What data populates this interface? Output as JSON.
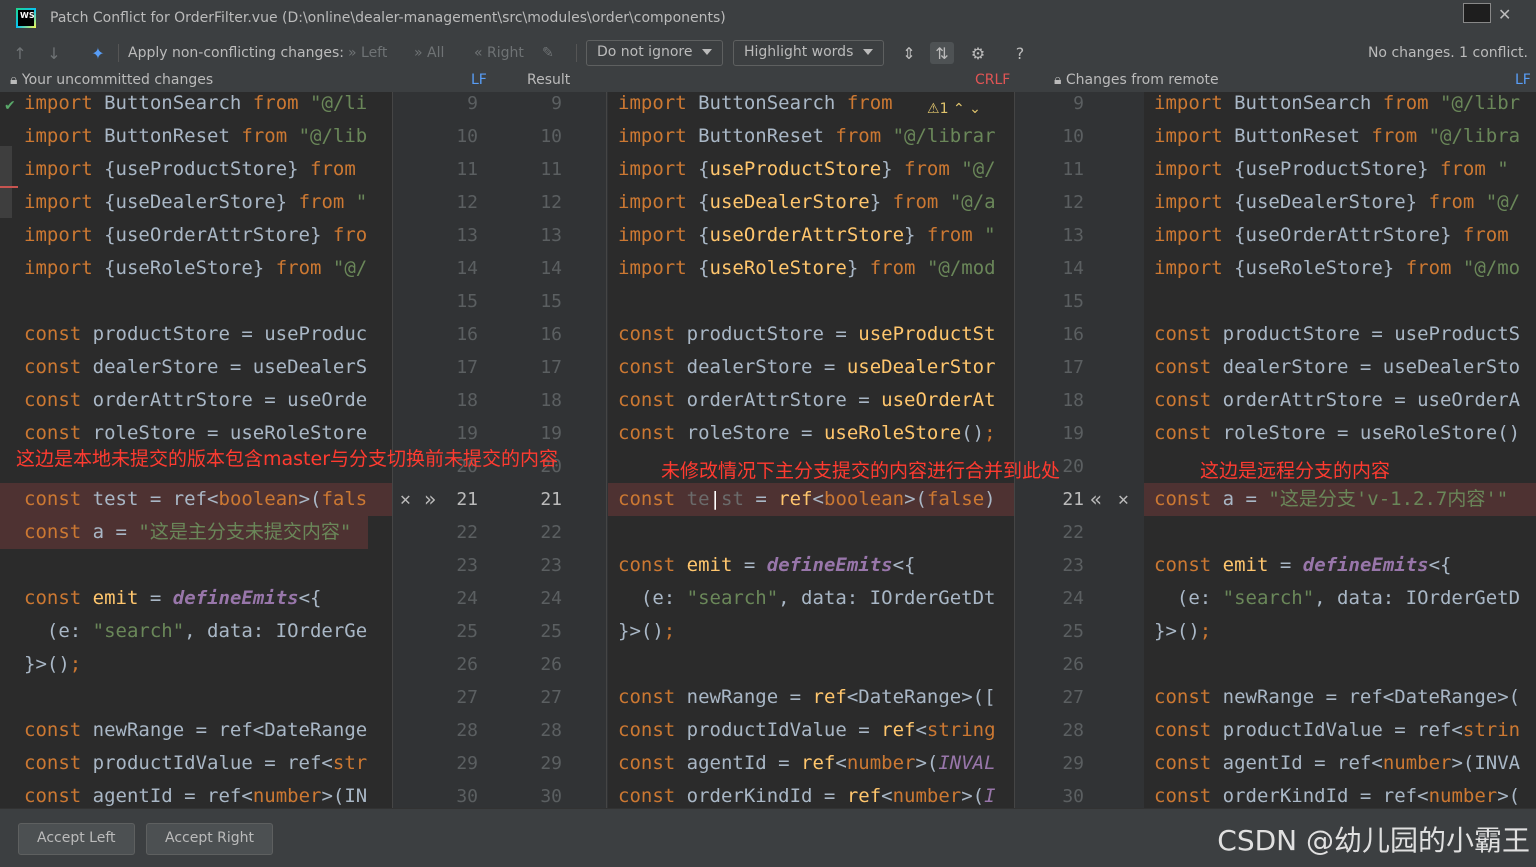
{
  "window": {
    "title": "Patch Conflict for OrderFilter.vue (D:\\online\\dealer-management\\src\\modules\\order\\components)",
    "logo_text": "WS"
  },
  "toolbar": {
    "apply_label": "Apply non-conflicting changes:",
    "left_label": "Left",
    "all_label": "All",
    "right_label": "Right",
    "ignore_dropdown": "Do not ignore",
    "highlight_dropdown": "Highlight words",
    "help": "?",
    "status": "No changes. 1 conflict."
  },
  "panels": {
    "left_title": "Your uncommitted changes",
    "left_sep": "LF",
    "middle_title": "Result",
    "middle_sep": "CRLF",
    "right_title": "Changes from remote",
    "right_sep": "LF"
  },
  "line_numbers": [
    "9",
    "10",
    "11",
    "12",
    "13",
    "14",
    "15",
    "16",
    "17",
    "18",
    "19",
    "20",
    "21",
    "22",
    "23",
    "24",
    "25",
    "26",
    "27",
    "28",
    "29",
    "30"
  ],
  "left_numbers": [
    "9",
    "10",
    "11",
    "12",
    "13",
    "14",
    "15",
    "16",
    "17",
    "18",
    "19",
    "20",
    "21",
    "22",
    "23",
    "24",
    "25",
    "26",
    "27",
    "28",
    "29",
    "30"
  ],
  "warning": "1",
  "annotations": {
    "left": "这边是本地未提交的版本包含master与分支切换前未提交的内容",
    "middle": "未修改情况下主分支提交的内容进行合并到此处",
    "right": "这边是远程分支的内容"
  },
  "bottom": {
    "accept_left": "Accept Left",
    "accept_right": "Accept Right",
    "watermark": "CSDN @幼儿园的小霸王"
  }
}
